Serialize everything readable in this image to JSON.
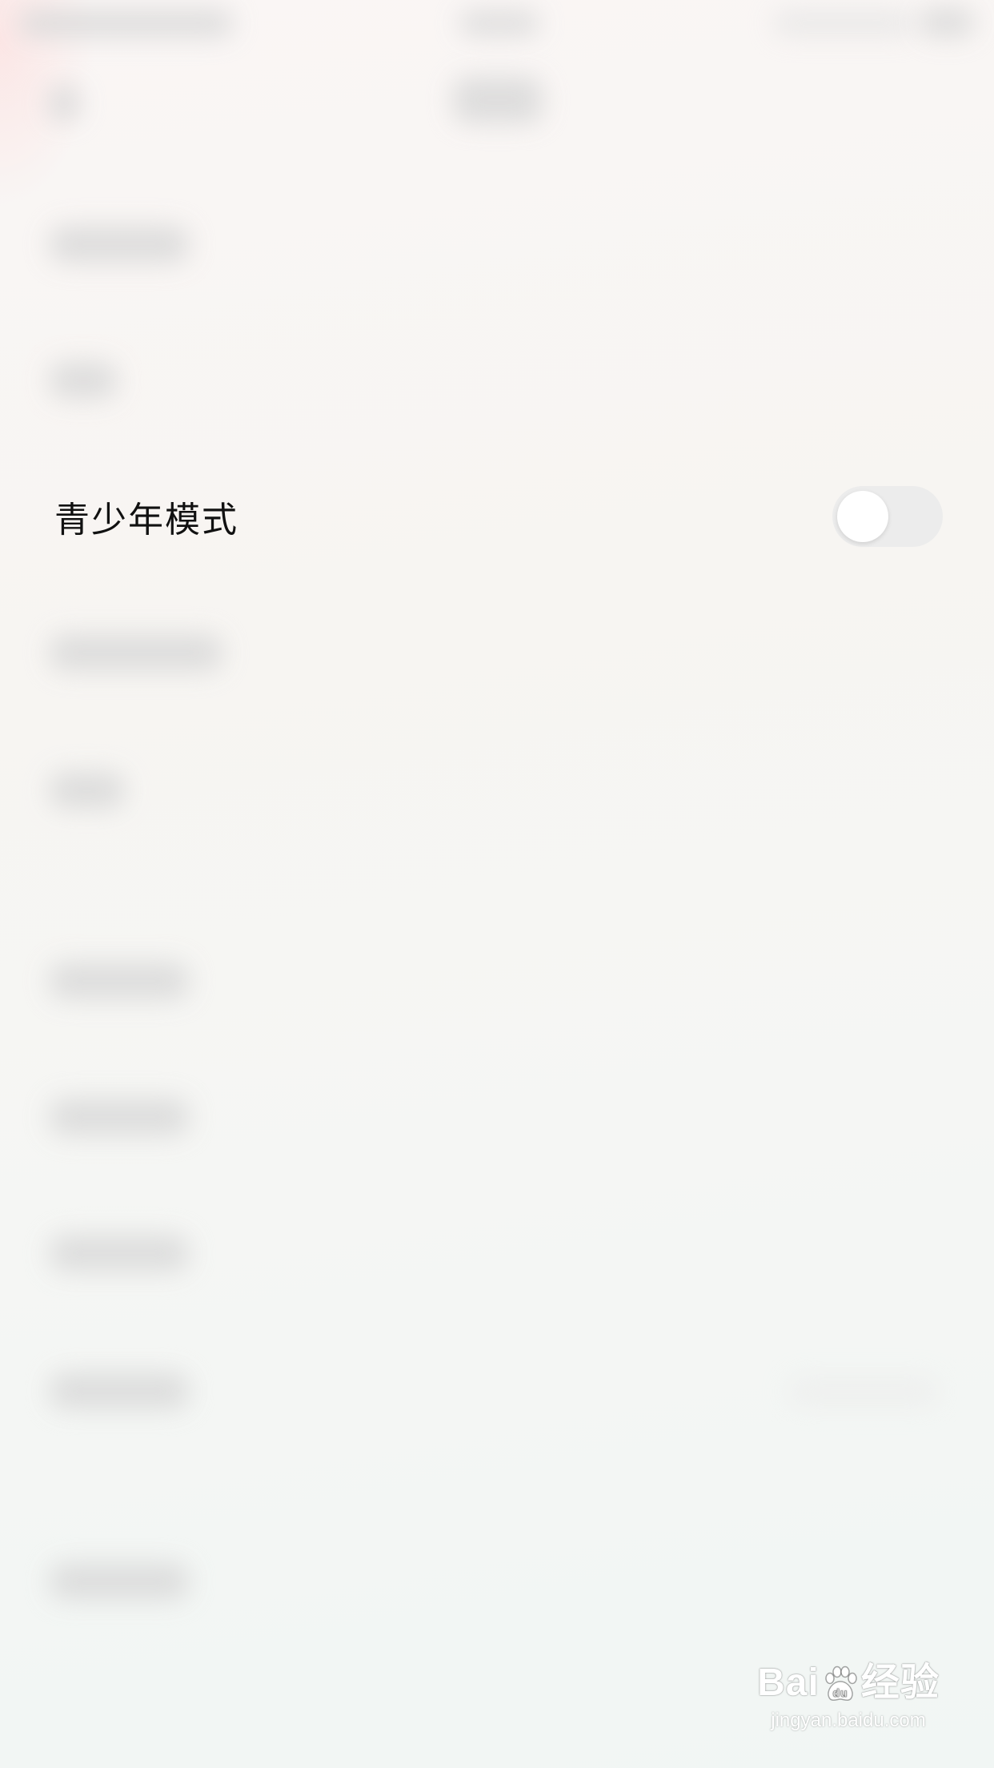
{
  "settings": {
    "teen_mode_label": "青少年模式",
    "teen_mode_enabled": false
  },
  "watermark": {
    "brand_left": "Bai",
    "brand_right": "经验",
    "url": "jingyan.baidu.com"
  }
}
